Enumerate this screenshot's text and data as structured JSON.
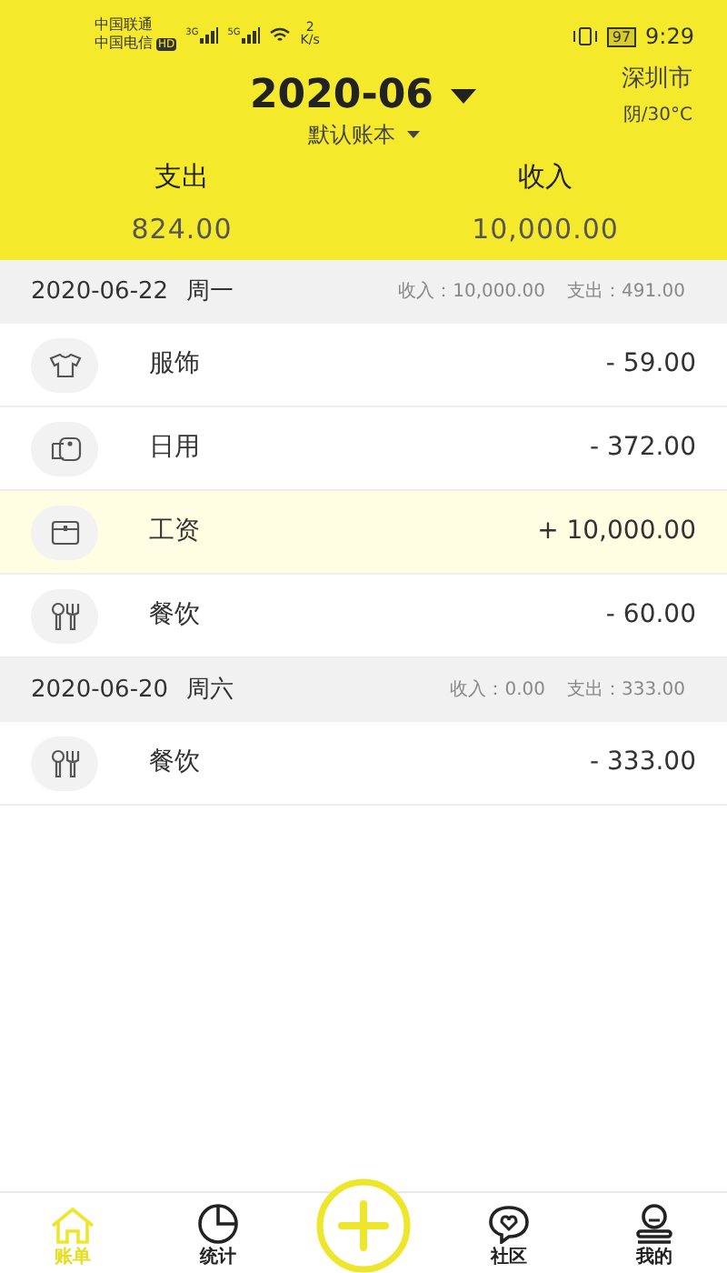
{
  "status_bar": {
    "carrier_1": "中国联通",
    "carrier_2": "中国电信",
    "hd": "HD",
    "net_type_1": "3G",
    "net_type_2": "5G",
    "speed": "2",
    "speed_unit": "K/s",
    "battery": "97",
    "time": "9:29"
  },
  "header": {
    "month": "2020-06",
    "book": "默认账本",
    "city": "深圳市",
    "weather": "阴/30°C",
    "expense_label": "支出",
    "expense_total": "824.00",
    "income_label": "收入",
    "income_total": "10,000.00"
  },
  "days": [
    {
      "date": "2020-06-22",
      "weekday": "周一",
      "income": "收入：10,000.00",
      "expense": "支出：491.00",
      "entries": [
        {
          "kind": "clothing",
          "category": "服饰",
          "amount": "- 59.00",
          "highlighted": false
        },
        {
          "kind": "daily",
          "category": "日用",
          "amount": "- 372.00",
          "highlighted": false
        },
        {
          "kind": "salary",
          "category": "工资",
          "amount": "+ 10,000.00",
          "highlighted": true
        },
        {
          "kind": "dining",
          "category": "餐饮",
          "amount": "- 60.00",
          "highlighted": false
        }
      ]
    },
    {
      "date": "2020-06-20",
      "weekday": "周六",
      "income": "收入：0.00",
      "expense": "支出：333.00",
      "entries": [
        {
          "kind": "dining",
          "category": "餐饮",
          "amount": "- 333.00",
          "highlighted": false
        }
      ]
    }
  ],
  "tab_bar": [
    {
      "kind": "home",
      "label": "账单",
      "selected": true
    },
    {
      "kind": "chart",
      "label": "统计",
      "selected": false
    },
    {
      "kind": "add"
    },
    {
      "kind": "community",
      "label": "社区",
      "selected": false
    },
    {
      "kind": "profile",
      "label": "我的",
      "selected": false
    }
  ]
}
